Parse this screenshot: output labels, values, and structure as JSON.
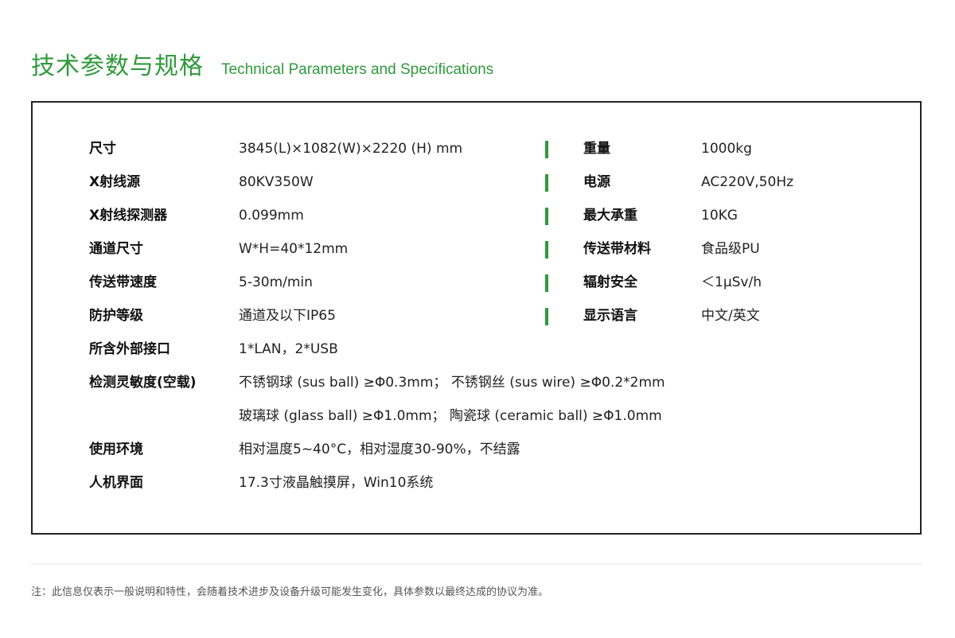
{
  "header": {
    "title_zh": "技术参数与规格",
    "title_en": "Technical Parameters and Specifications"
  },
  "specs": {
    "rows": [
      {
        "label": "尺寸",
        "value": "3845(L)×1082(W)×2220 (H) mm",
        "right_label": "重量",
        "right_value": "1000kg"
      },
      {
        "label": "X射线源",
        "value": "80KV350W",
        "right_label": "电源",
        "right_value": "AC220V,50Hz"
      },
      {
        "label": "X射线探测器",
        "value": "0.099mm",
        "right_label": "最大承重",
        "right_value": "10KG"
      },
      {
        "label": "通道尺寸",
        "value": "W*H=40*12mm",
        "right_label": "传送带材料",
        "right_value": "食品级PU"
      },
      {
        "label": "传送带速度",
        "value": "5-30m/min",
        "right_label": "辐射安全",
        "right_value": "＜1μSv/h"
      },
      {
        "label": "防护等级",
        "value": "通道及以下IP65",
        "right_label": "显示语言",
        "right_value": "中文/英文"
      },
      {
        "label": "所含外部接口",
        "value": "1*LAN，2*USB"
      },
      {
        "label": "检测灵敏度(空载)",
        "value": "不锈钢球 (sus ball) ≥Φ0.3mm； 不锈钢丝 (sus wire) ≥Φ0.2*2mm"
      },
      {
        "label": "",
        "value": "玻璃球 (glass ball) ≥Φ1.0mm； 陶瓷球 (ceramic ball) ≥Φ1.0mm"
      },
      {
        "label": "使用环境",
        "value": "相对温度5~40°C，相对湿度30-90%，不结露"
      },
      {
        "label": "人机界面",
        "value": "17.3寸液晶触摸屏，Win10系统"
      }
    ]
  },
  "footer": {
    "note": "注：此信息仅表示一般说明和特性，会随着技术进步及设备升级可能发生变化，具体参数以最终达成的协议为准。"
  },
  "colors": {
    "accent": "#2f9a3c",
    "border": "#222222",
    "text": "#222222"
  }
}
